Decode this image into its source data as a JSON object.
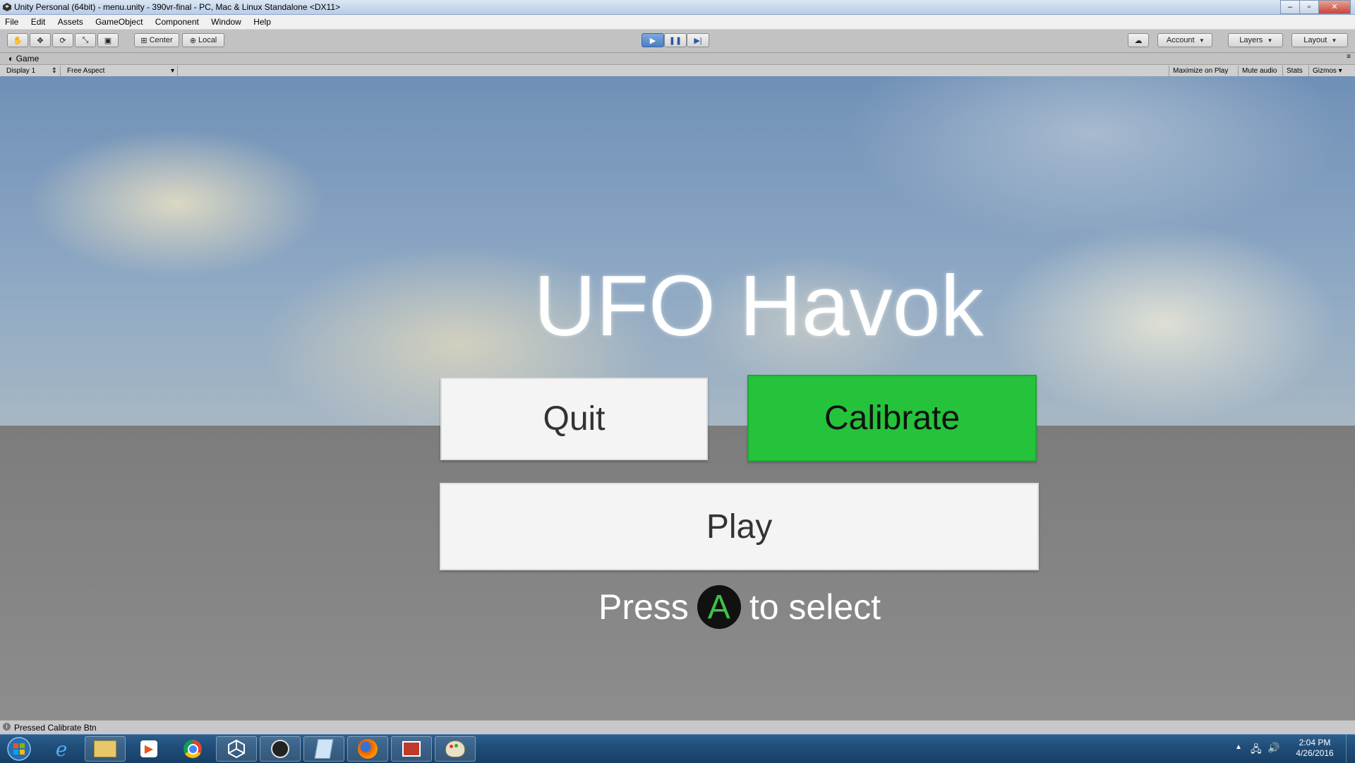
{
  "window": {
    "title": "Unity Personal (64bit) - menu.unity - 390vr-final - PC, Mac & Linux Standalone <DX11>",
    "controls": [
      "minimize-icon",
      "maximize-icon",
      "close-icon"
    ]
  },
  "menubar": {
    "items": [
      "File",
      "Edit",
      "Assets",
      "GameObject",
      "Component",
      "Window",
      "Help"
    ]
  },
  "toolbar": {
    "tools": [
      "hand-icon",
      "move-icon",
      "rotate-icon",
      "scale-icon",
      "rect-icon"
    ],
    "pivot_label": "Center",
    "space_label": "Local",
    "account_label": "Account",
    "layers_label": "Layers",
    "layout_label": "Layout"
  },
  "game_panel": {
    "tab_label": "Game",
    "display_label": "Display 1",
    "aspect_label": "Free Aspect",
    "maximize_label": "Maximize on Play",
    "mute_label": "Mute audio",
    "stats_label": "Stats",
    "gizmos_label": "Gizmos"
  },
  "game": {
    "title": "UFO Havok",
    "quit_label": "Quit",
    "calibrate_label": "Calibrate",
    "play_label": "Play",
    "hint_prefix": "Press",
    "hint_button": "A",
    "hint_suffix": "to select",
    "selected_color": "#25c33b"
  },
  "status": {
    "message": "Pressed Calibrate Btn"
  },
  "taskbar": {
    "apps": [
      "internet-explorer-icon",
      "file-explorer-icon",
      "media-player-icon",
      "chrome-icon",
      "unity-icon",
      "obs-icon",
      "notepad-icon",
      "firefox-icon",
      "video-editor-icon",
      "paint-icon"
    ],
    "time": "2:04 PM",
    "date": "4/26/2016"
  }
}
